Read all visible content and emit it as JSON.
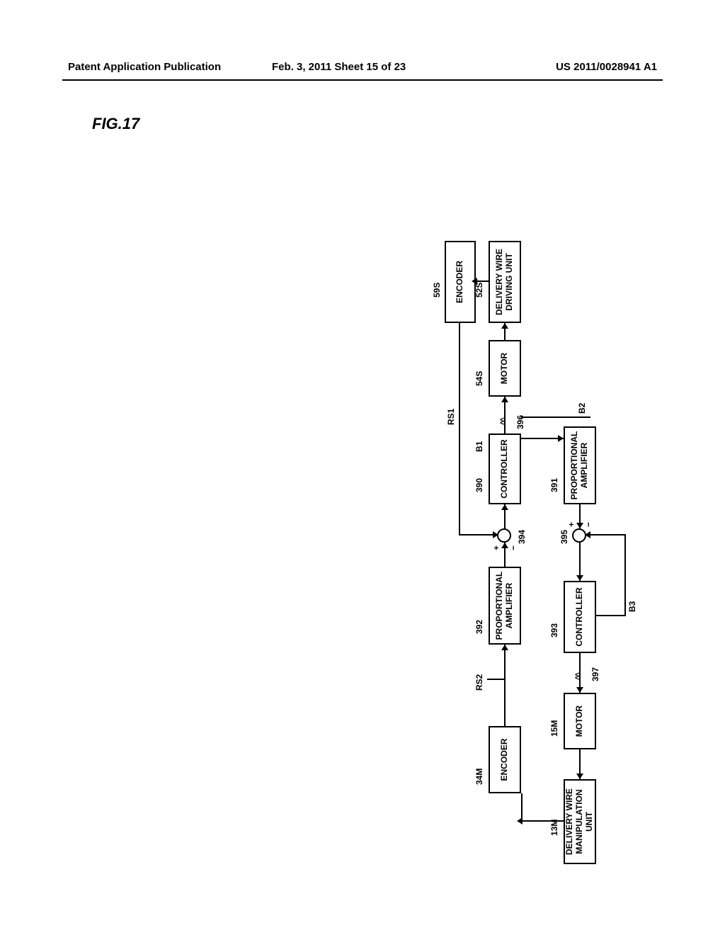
{
  "header": {
    "left": "Patent Application Publication",
    "mid": "Feb. 3, 2011   Sheet 15 of 23",
    "right": "US 2011/0028941 A1"
  },
  "fig_title": "FIG.17",
  "labels": {
    "encoder_m": "ENCODER",
    "encoder_s": "ENCODER",
    "motor_m": "MOTOR",
    "motor_s": "MOTOR",
    "controller_390": "CONTROLLER",
    "controller_393": "CONTROLLER",
    "propamp_391": "PROPORTIONAL AMPLIFIER",
    "propamp_392": "PROPORTIONAL AMPLIFIER",
    "delwire_manip": "DELIVERY WIRE MANIPULATION UNIT",
    "delwire_drive": "DELIVERY WIRE DRIVING UNIT"
  },
  "refs": {
    "r34M": "34M",
    "r13M": "13M",
    "r15M": "15M",
    "r59S": "59S",
    "r52S": "52S",
    "r54S": "54S",
    "r390": "390",
    "r391": "391",
    "r392": "392",
    "r393": "393",
    "r394": "394",
    "r395": "395",
    "r396": "396",
    "r397": "397",
    "rRS1": "RS1",
    "rRS2": "RS2",
    "rB1": "B1",
    "rB2": "B2",
    "rB3": "B3"
  },
  "signs": {
    "plus": "+",
    "minus": "−"
  }
}
